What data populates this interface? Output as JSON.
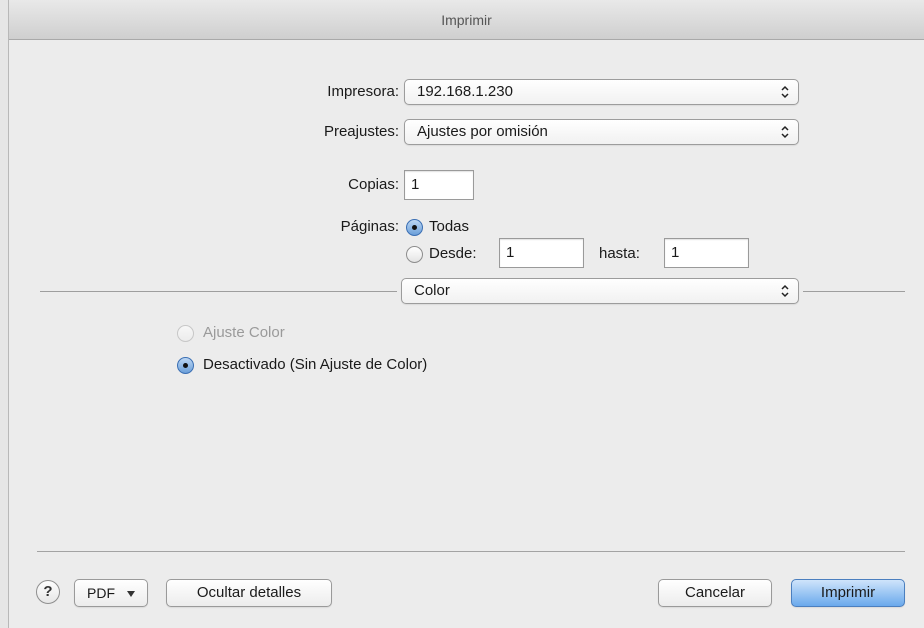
{
  "window": {
    "title": "Imprimir"
  },
  "printer": {
    "label": "Impresora:",
    "value": "192.168.1.230"
  },
  "presets": {
    "label": "Preajustes:",
    "value": "Ajustes por omisión"
  },
  "copies": {
    "label": "Copias:",
    "value": "1"
  },
  "pages": {
    "label": "Páginas:",
    "all_label": "Todas",
    "from_label": "Desde:",
    "from_value": "1",
    "to_label": "hasta:",
    "to_value": "1",
    "selected": "all"
  },
  "section_popup": {
    "value": "Color"
  },
  "color_options": {
    "option1": {
      "label": "Ajuste Color",
      "enabled": false
    },
    "option2": {
      "label": "Desactivado (Sin Ajuste de Color)",
      "selected": true
    }
  },
  "footer": {
    "help_label": "?",
    "pdf_label": "PDF",
    "hide_details_label": "Ocultar detalles",
    "cancel_label": "Cancelar",
    "print_label": "Imprimir"
  },
  "icons": {
    "popup_arrows": "up-down-chevron-icon",
    "pdf_menu": "triangle-down-icon",
    "help": "question-mark-icon"
  },
  "colors": {
    "window_bg": "#ececec",
    "primary_button": "#6aa9ec",
    "radio_selected": "#6b9fd9"
  }
}
